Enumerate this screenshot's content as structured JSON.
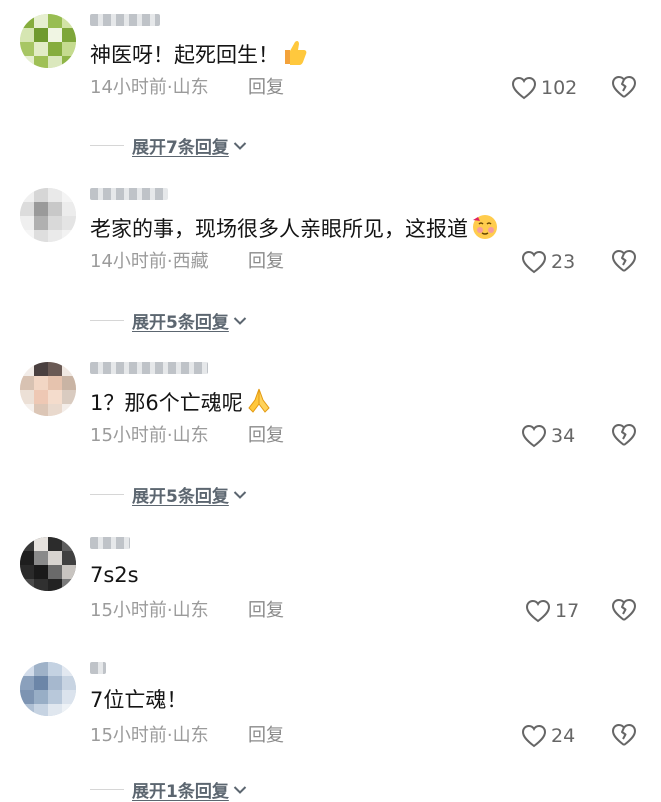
{
  "comments": [
    {
      "text": "神医呀！起死回生！",
      "emoji": "thumbs-up",
      "meta": "14小时前·山东",
      "reply": "回复",
      "likes": "102",
      "expand": "展开7条回复"
    },
    {
      "text": "老家的事，现场很多人亲眼所见，这报道",
      "emoji": "blushing-face",
      "meta": "14小时前·西藏",
      "reply": "回复",
      "likes": "23",
      "expand": "展开5条回复"
    },
    {
      "text": "1？那6个亡魂呢",
      "emoji": "folded-hands",
      "meta": "15小时前·山东",
      "reply": "回复",
      "likes": "34",
      "expand": "展开5条回复"
    },
    {
      "text": "7s2s",
      "meta": "15小时前·山东",
      "reply": "回复",
      "likes": "17"
    },
    {
      "text": "7位亡魂！",
      "meta": "15小时前·山东",
      "reply": "回复",
      "likes": "24",
      "expand": "展开1条回复"
    }
  ]
}
